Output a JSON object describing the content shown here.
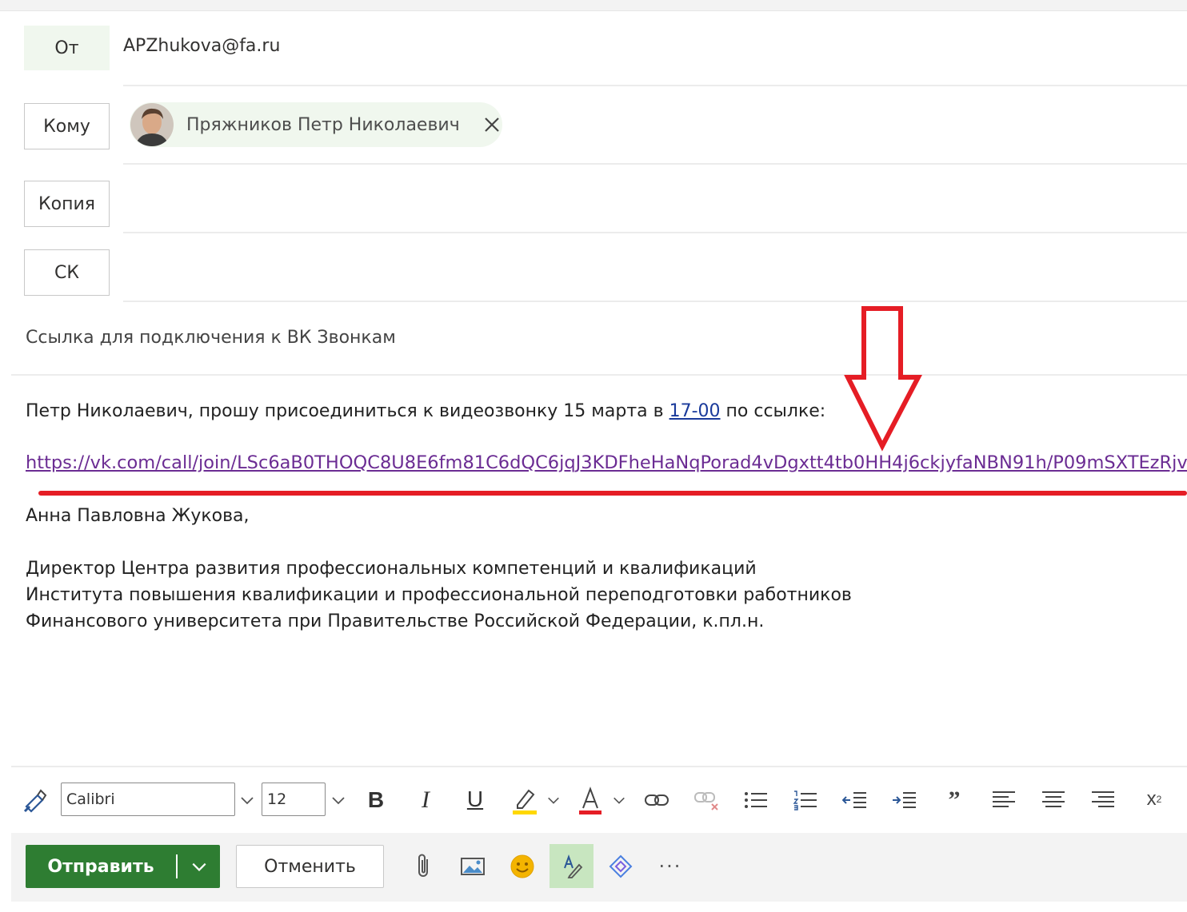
{
  "header": {
    "from_label": "От",
    "from_value": "APZhukova@fa.ru",
    "to_label": "Кому",
    "cc_label": "Копия",
    "bcc_label": "СК"
  },
  "recipients": [
    {
      "name": "Пряжников Петр Николаевич",
      "remove_icon": "close-icon"
    }
  ],
  "subject": "Ссылка для подключения к ВК Звонкам",
  "body": {
    "greeting_prefix": "Петр Николаевич, прошу присоединиться к видеозвонку 15 марта в ",
    "greeting_time": "17-00",
    "greeting_suffix": " по ссылке:",
    "call_link": "https://vk.com/call/join/LSc6aB0THOQC8U8E6fm81C6dQC6jqJ3KDFheHaNqPorad4vDgxtt4tb0HH4j6ckjyfaNBN91h/P09mSXTEzRjv",
    "signature_name": "Анна Павловна Жукова,",
    "signature_lines": [
      "Директор Центра развития профессиональных компетенций и квалификаций",
      "Института повышения квалификации и профессиональной переподготовки работников",
      "Финансового университета при Правительстве Российской Федерации, к.пл.н."
    ]
  },
  "annotation": {
    "arrow_color": "#e51d25",
    "underline_color": "#e51d25"
  },
  "toolbar": {
    "font_family": "Calibri",
    "font_size": "12",
    "icons": [
      "format-painter-icon",
      "bold-icon",
      "italic-icon",
      "underline-icon",
      "highlight-icon",
      "font-color-icon",
      "insert-link-icon",
      "remove-link-icon",
      "bullets-icon",
      "numbering-icon",
      "decrease-indent-icon",
      "increase-indent-icon",
      "quote-icon",
      "align-left-icon",
      "align-center-icon",
      "align-right-icon",
      "superscript-icon"
    ]
  },
  "actions": {
    "send_label": "Отправить",
    "discard_label": "Отменить",
    "icons": [
      "attach-icon",
      "insert-picture-icon",
      "emoji-icon",
      "editor-icon",
      "loop-icon",
      "more-icon"
    ]
  },
  "colors": {
    "send_button": "#2e7d32",
    "link": "#6b2c93",
    "highlight_bar": "#ffd800",
    "font_color_bar": "#e51d25"
  }
}
